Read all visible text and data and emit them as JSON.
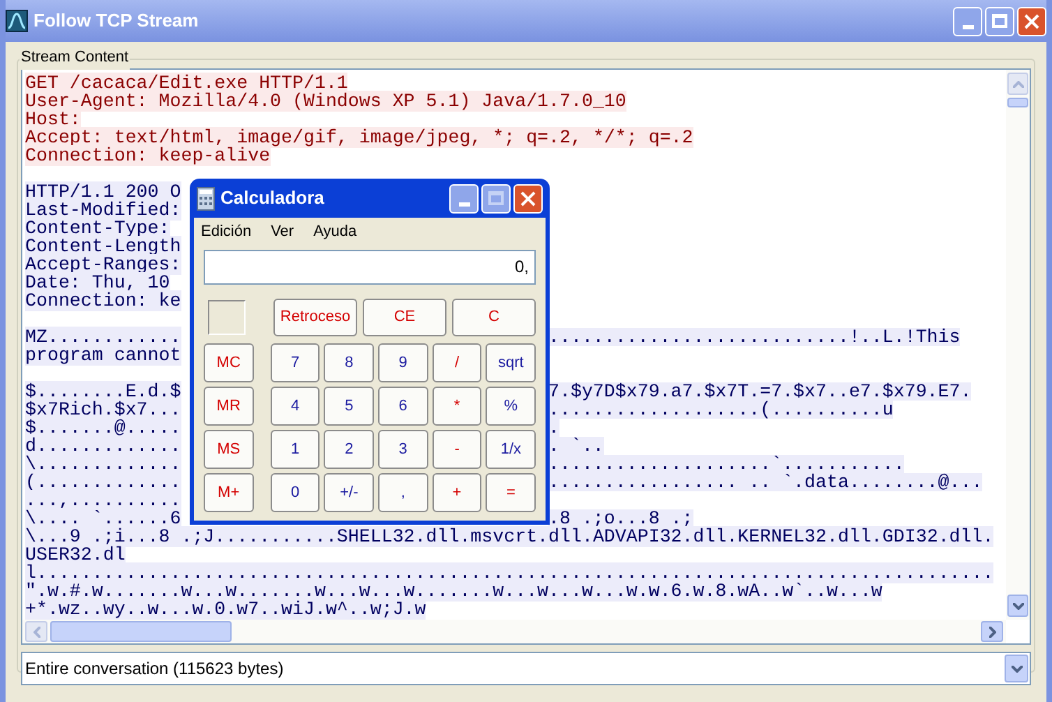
{
  "window": {
    "title": "Follow TCP Stream"
  },
  "group_label": "Stream Content",
  "stream": [
    {
      "kind": "client",
      "text": "GET /cacaca/Edit.exe HTTP/1.1"
    },
    {
      "kind": "client",
      "text": "User-Agent: Mozilla/4.0 (Windows XP 5.1) Java/1.7.0_10"
    },
    {
      "kind": "client",
      "text": "Host:"
    },
    {
      "kind": "client",
      "text": "Accept: text/html, image/gif, image/jpeg, *; q=.2, */*; q=.2"
    },
    {
      "kind": "client",
      "text": "Connection: keep-alive"
    },
    {
      "kind": "blank"
    },
    {
      "kind": "server",
      "text": "HTTP/1.1 200 O"
    },
    {
      "kind": "server",
      "text": "Last-Modified:"
    },
    {
      "kind": "server",
      "text": "Content-Type:"
    },
    {
      "kind": "server",
      "text": "Content-Length"
    },
    {
      "kind": "server",
      "text": "Accept-Ranges:"
    },
    {
      "kind": "server",
      "text": "Date: Thu, 10"
    },
    {
      "kind": "server",
      "text": "Connection: ke"
    },
    {
      "kind": "blank"
    },
    {
      "kind": "server",
      "text": "MZ............",
      "right": "...........................!..L.!This"
    },
    {
      "kind": "server",
      "text": "program cannot"
    },
    {
      "kind": "blank"
    },
    {
      "kind": "server",
      "text": "$........E.d.$",
      "right": "7.$y7D$x79.a7.$x7T.=7.$x7..e7.$x79.E7."
    },
    {
      "kind": "server",
      "text": "$x7Rich.$x7...",
      "right": "...................(..........u"
    },
    {
      "kind": "server",
      "text": "$.......@.....",
      "right": "."
    },
    {
      "kind": "server",
      "text": "d.............",
      "right": ". `.."
    },
    {
      "kind": "server",
      "text": "\\.............",
      "right": "....................`..........."
    },
    {
      "kind": "server",
      "text": "(.............",
      "right": "................. .. `.data........@..."
    },
    {
      "kind": "server",
      "text": "...,.........."
    },
    {
      "kind": "server",
      "text": "\\.... `......6",
      "right": ".8 .;o...8 .;"
    },
    {
      "kind": "server",
      "text": "\\...9 .;i...8 .;J...........SHELL32.dll.msvcrt.dll.ADVAPI32.dll.KERNEL32.dll.GDI32.dll."
    },
    {
      "kind": "server",
      "text": "USER32.dl"
    },
    {
      "kind": "server",
      "text": "l......................................................................................"
    },
    {
      "kind": "server",
      "text": "\".w.#.w.......w...w.......w...w...w.......w...w...w...w.w.6.w.8.wA..w`..w...w"
    },
    {
      "kind": "server",
      "text": "+*.wz..wy..w...w.0.w7..wiJ.w^..w;J.w"
    }
  ],
  "conversation_select": {
    "value": "Entire conversation (115623 bytes)"
  },
  "calculator": {
    "title": "Calculadora",
    "menu": [
      "Edición",
      "Ver",
      "Ayuda"
    ],
    "display": "0,",
    "top_buttons": [
      "Retroceso",
      "CE",
      "C"
    ],
    "rows": [
      [
        {
          "label": "MC",
          "kind": "memory"
        },
        {
          "label": "7",
          "kind": "digit"
        },
        {
          "label": "8",
          "kind": "digit"
        },
        {
          "label": "9",
          "kind": "digit"
        },
        {
          "label": "/",
          "kind": "operator"
        },
        {
          "label": "sqrt",
          "kind": "function"
        }
      ],
      [
        {
          "label": "MR",
          "kind": "memory"
        },
        {
          "label": "4",
          "kind": "digit"
        },
        {
          "label": "5",
          "kind": "digit"
        },
        {
          "label": "6",
          "kind": "digit"
        },
        {
          "label": "*",
          "kind": "operator"
        },
        {
          "label": "%",
          "kind": "function"
        }
      ],
      [
        {
          "label": "MS",
          "kind": "memory"
        },
        {
          "label": "1",
          "kind": "digit"
        },
        {
          "label": "2",
          "kind": "digit"
        },
        {
          "label": "3",
          "kind": "digit"
        },
        {
          "label": "-",
          "kind": "operator"
        },
        {
          "label": "1/x",
          "kind": "function"
        }
      ],
      [
        {
          "label": "M+",
          "kind": "memory"
        },
        {
          "label": "0",
          "kind": "digit"
        },
        {
          "label": "+/-",
          "kind": "function"
        },
        {
          "label": ",",
          "kind": "function"
        },
        {
          "label": "+",
          "kind": "operator"
        },
        {
          "label": "=",
          "kind": "operator"
        }
      ]
    ]
  }
}
